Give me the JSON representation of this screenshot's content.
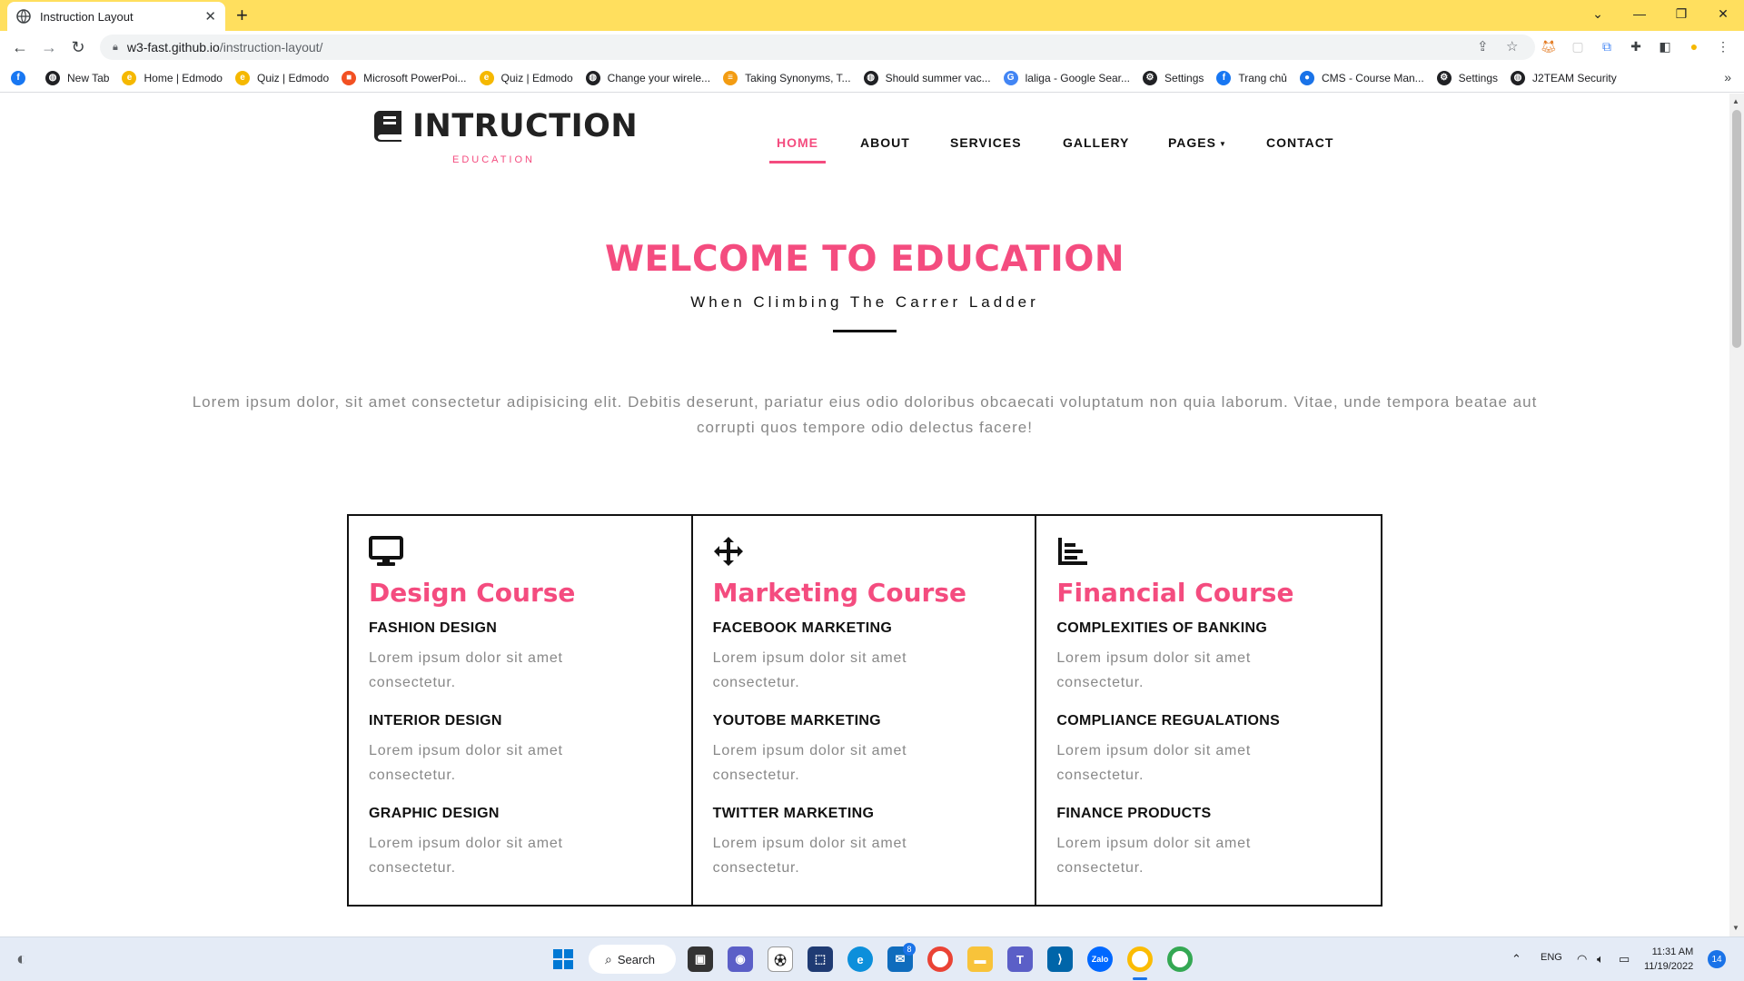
{
  "browser": {
    "tab_title": "Instruction Layout",
    "url_host": "w3-fast.github.io",
    "url_path": "/instruction-layout/",
    "bookmarks": [
      {
        "label": "",
        "icon": "facebook-icon",
        "color": "#1877F2"
      },
      {
        "label": "New Tab",
        "icon": "globe-icon",
        "color": "#202124"
      },
      {
        "label": "Home | Edmodo",
        "icon": "edmodo-icon",
        "color": "#F5B800"
      },
      {
        "label": "Quiz | Edmodo",
        "icon": "edmodo-icon",
        "color": "#F5B800"
      },
      {
        "label": "Microsoft PowerPoi...",
        "icon": "microsoft-icon",
        "color": "#F25022"
      },
      {
        "label": "Quiz | Edmodo",
        "icon": "edmodo-icon",
        "color": "#F5B800"
      },
      {
        "label": "Change your wirele...",
        "icon": "globe-icon",
        "color": "#202124"
      },
      {
        "label": "Taking Synonyms, T...",
        "icon": "thesaurus-icon",
        "color": "#F39C12"
      },
      {
        "label": "Should summer vac...",
        "icon": "globe-icon",
        "color": "#202124"
      },
      {
        "label": "laliga - Google Sear...",
        "icon": "google-icon",
        "color": "#4285F4"
      },
      {
        "label": "Settings",
        "icon": "gear-icon",
        "color": "#202124"
      },
      {
        "label": "Trang chủ",
        "icon": "facebook-icon",
        "color": "#1877F2"
      },
      {
        "label": "CMS - Course Man...",
        "icon": "cms-icon",
        "color": "#1a73e8"
      },
      {
        "label": "Settings",
        "icon": "gear-icon",
        "color": "#202124"
      },
      {
        "label": "J2TEAM Security",
        "icon": "globe-icon",
        "color": "#202124"
      }
    ]
  },
  "site": {
    "logo": {
      "name": "INTRUCTION",
      "sub": "EDUCATION"
    },
    "nav": [
      {
        "label": "HOME",
        "active": true
      },
      {
        "label": "ABOUT",
        "active": false
      },
      {
        "label": "SERVICES",
        "active": false
      },
      {
        "label": "GALLERY",
        "active": false
      },
      {
        "label": "PAGES",
        "active": false
      },
      {
        "label": "CONTACT",
        "active": false
      }
    ],
    "hero": {
      "title": "WELCOME TO EDUCATION",
      "subtitle": "When Climbing The Carrer Ladder",
      "text": "Lorem ipsum dolor, sit amet consectetur adipisicing elit. Debitis deserunt, pariatur eius odio doloribus obcaecati voluptatum non quia laborum. Vitae, unde tempora beatae aut corrupti quos tempore odio delectus facere!"
    },
    "courses": [
      {
        "icon": "desktop-icon",
        "title": "Design Course",
        "items": [
          {
            "heading": "FASHION DESIGN",
            "text": "Lorem ipsum dolor sit amet consectetur."
          },
          {
            "heading": "INTERIOR DESIGN",
            "text": "Lorem ipsum dolor sit amet consectetur."
          },
          {
            "heading": "GRAPHIC DESIGN",
            "text": "Lorem ipsum dolor sit amet consectetur."
          }
        ]
      },
      {
        "icon": "move-arrows-icon",
        "title": "Marketing Course",
        "items": [
          {
            "heading": "FACEBOOK MARKETING",
            "text": "Lorem ipsum dolor sit amet consectetur."
          },
          {
            "heading": "YOUTOBE MARKETING",
            "text": "Lorem ipsum dolor sit amet consectetur."
          },
          {
            "heading": "TWITTER MARKETING",
            "text": "Lorem ipsum dolor sit amet consectetur."
          }
        ]
      },
      {
        "icon": "bar-chart-icon",
        "title": "Financial Course",
        "items": [
          {
            "heading": "COMPLEXITIES OF BANKING",
            "text": "Lorem ipsum dolor sit amet consectetur."
          },
          {
            "heading": "COMPLIANCE REGUALATIONS",
            "text": "Lorem ipsum dolor sit amet consectetur."
          },
          {
            "heading": "FINANCE PRODUCTS",
            "text": "Lorem ipsum dolor sit amet consectetur."
          }
        ]
      }
    ]
  },
  "taskbar": {
    "search_label": "Search",
    "language": "ENG",
    "time": "11:31 AM",
    "date": "11/19/2022",
    "notifications": "14",
    "mail_badge": "8"
  },
  "colors": {
    "accent": "#F44C7F",
    "chrome_tab_bar": "#FFDF5E"
  }
}
